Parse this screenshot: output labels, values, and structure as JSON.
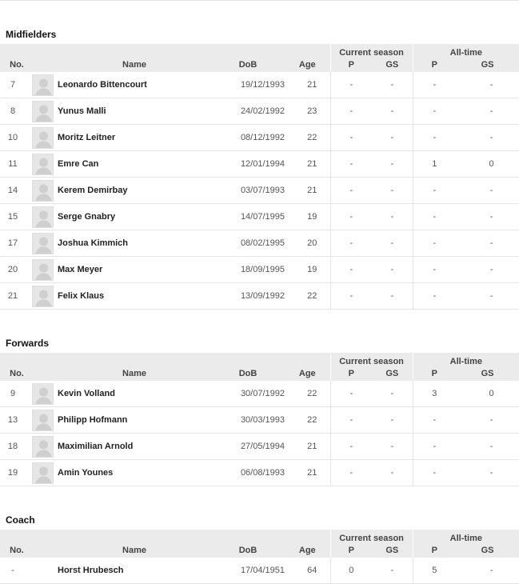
{
  "columns": {
    "no": "No.",
    "name": "Name",
    "dob": "DoB",
    "age": "Age",
    "current_season": "Current season",
    "all_time": "All-time",
    "p": "P",
    "gs": "GS"
  },
  "sections": [
    {
      "title": "Midfielders",
      "players": [
        {
          "no": "7",
          "name": "Leonardo Bittencourt",
          "dob": "19/12/1993",
          "age": "21",
          "cp": "-",
          "cgs": "-",
          "ap": "-",
          "ags": "-"
        },
        {
          "no": "8",
          "name": "Yunus Malli",
          "dob": "24/02/1992",
          "age": "23",
          "cp": "-",
          "cgs": "-",
          "ap": "-",
          "ags": "-"
        },
        {
          "no": "10",
          "name": "Moritz Leitner",
          "dob": "08/12/1992",
          "age": "22",
          "cp": "-",
          "cgs": "-",
          "ap": "-",
          "ags": "-"
        },
        {
          "no": "11",
          "name": "Emre Can",
          "dob": "12/01/1994",
          "age": "21",
          "cp": "-",
          "cgs": "-",
          "ap": "1",
          "ags": "0"
        },
        {
          "no": "14",
          "name": "Kerem Demirbay",
          "dob": "03/07/1993",
          "age": "21",
          "cp": "-",
          "cgs": "-",
          "ap": "-",
          "ags": "-"
        },
        {
          "no": "15",
          "name": "Serge Gnabry",
          "dob": "14/07/1995",
          "age": "19",
          "cp": "-",
          "cgs": "-",
          "ap": "-",
          "ags": "-"
        },
        {
          "no": "17",
          "name": "Joshua Kimmich",
          "dob": "08/02/1995",
          "age": "20",
          "cp": "-",
          "cgs": "-",
          "ap": "-",
          "ags": "-"
        },
        {
          "no": "20",
          "name": "Max Meyer",
          "dob": "18/09/1995",
          "age": "19",
          "cp": "-",
          "cgs": "-",
          "ap": "-",
          "ags": "-"
        },
        {
          "no": "21",
          "name": "Felix Klaus",
          "dob": "13/09/1992",
          "age": "22",
          "cp": "-",
          "cgs": "-",
          "ap": "-",
          "ags": "-"
        }
      ]
    },
    {
      "title": "Forwards",
      "players": [
        {
          "no": "9",
          "name": "Kevin Volland",
          "dob": "30/07/1992",
          "age": "22",
          "cp": "-",
          "cgs": "-",
          "ap": "3",
          "ags": "0"
        },
        {
          "no": "13",
          "name": "Philipp Hofmann",
          "dob": "30/03/1993",
          "age": "22",
          "cp": "-",
          "cgs": "-",
          "ap": "-",
          "ags": "-"
        },
        {
          "no": "18",
          "name": "Maximilian Arnold",
          "dob": "27/05/1994",
          "age": "21",
          "cp": "-",
          "cgs": "-",
          "ap": "-",
          "ags": "-"
        },
        {
          "no": "19",
          "name": "Amin Younes",
          "dob": "06/08/1993",
          "age": "21",
          "cp": "-",
          "cgs": "-",
          "ap": "-",
          "ags": "-"
        }
      ]
    },
    {
      "title": "Coach",
      "players": [
        {
          "no": "-",
          "name": "Horst Hrubesch",
          "dob": "17/04/1951",
          "age": "64",
          "cp": "0",
          "cgs": "-",
          "ap": "5",
          "ags": "-",
          "no_photo": true
        }
      ]
    }
  ]
}
